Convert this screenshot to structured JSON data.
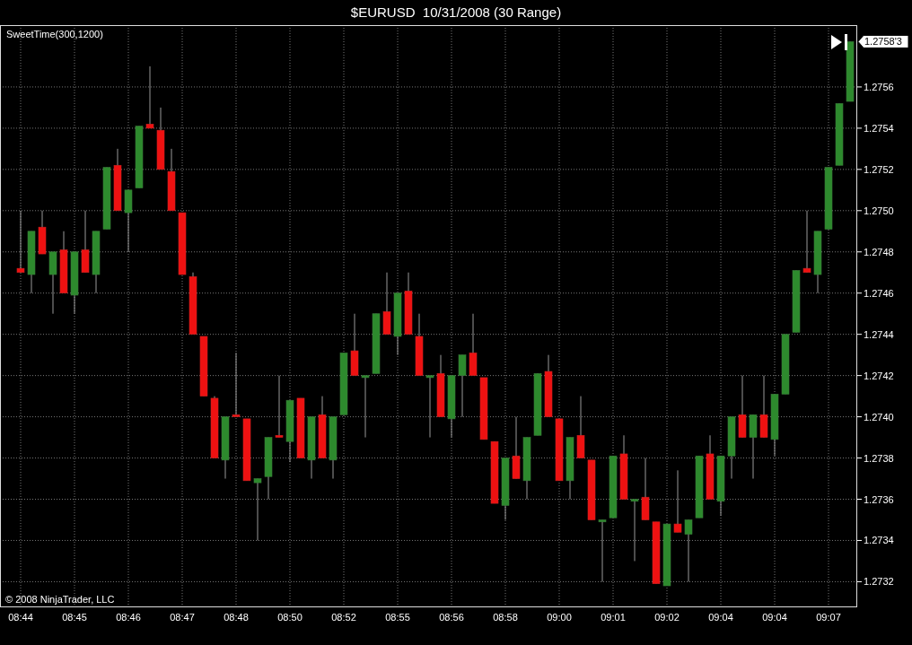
{
  "window": {
    "title": "$EURUSD  10/31/2008 (30 Range)"
  },
  "chart": {
    "indicator_label": "SweetTime(300,1200)",
    "copyright": "© 2008 NinjaTrader, LLC",
    "last_price": "1.2758'3",
    "chart_data": {
      "type": "candlestick",
      "grid": true,
      "ylim": [
        1.27308,
        1.2759
      ],
      "categories": [
        "08:44",
        null,
        null,
        null,
        null,
        "08:45",
        null,
        null,
        null,
        null,
        "08:46",
        null,
        null,
        null,
        null,
        "08:47",
        null,
        null,
        null,
        null,
        "08:48",
        null,
        null,
        null,
        null,
        "08:50",
        null,
        null,
        null,
        null,
        "08:52",
        null,
        null,
        null,
        null,
        "08:55",
        null,
        null,
        null,
        null,
        "08:56",
        null,
        null,
        null,
        null,
        "08:58",
        null,
        null,
        null,
        null,
        "09:00",
        null,
        null,
        null,
        null,
        "09:01",
        null,
        null,
        null,
        null,
        "09:02",
        null,
        null,
        null,
        null,
        "09:04",
        null,
        null,
        null,
        null,
        "09:04",
        null,
        null,
        null,
        null,
        "09:07",
        null,
        null
      ],
      "yticks": [
        {
          "value": 1.2732,
          "label": "1.2732"
        },
        {
          "value": 1.2734,
          "label": "1.2734"
        },
        {
          "value": 1.2736,
          "label": "1.2736"
        },
        {
          "value": 1.2738,
          "label": "1.2738"
        },
        {
          "value": 1.274,
          "label": "1.2740"
        },
        {
          "value": 1.2742,
          "label": "1.2742"
        },
        {
          "value": 1.2744,
          "label": "1.2744"
        },
        {
          "value": 1.2746,
          "label": "1.2746"
        },
        {
          "value": 1.2748,
          "label": "1.2748"
        },
        {
          "value": 1.275,
          "label": "1.2750"
        },
        {
          "value": 1.2752,
          "label": "1.2752"
        },
        {
          "value": 1.2754,
          "label": "1.2754"
        },
        {
          "value": 1.2756,
          "label": "1.2756"
        }
      ],
      "ohlc": [
        [
          1.27472,
          1.275,
          1.2747,
          1.2747
        ],
        [
          1.27469,
          1.2749,
          1.2746,
          1.2749
        ],
        [
          1.27492,
          1.275,
          1.27479,
          1.27479
        ],
        [
          1.27469,
          1.2748,
          1.2745,
          1.2748
        ],
        [
          1.27481,
          1.2749,
          1.2746,
          1.2746
        ],
        [
          1.27459,
          1.2748,
          1.2745,
          1.2748
        ],
        [
          1.27481,
          1.275,
          1.2747,
          1.2747
        ],
        [
          1.27469,
          1.2749,
          1.2746,
          1.2749
        ],
        [
          1.27491,
          1.27521,
          1.27491,
          1.27521
        ],
        [
          1.27522,
          1.2753,
          1.275,
          1.275
        ],
        [
          1.27499,
          1.2751,
          1.2748,
          1.2751
        ],
        [
          1.27511,
          1.27541,
          1.27511,
          1.27541
        ],
        [
          1.27542,
          1.2757,
          1.2754,
          1.2754
        ],
        [
          1.27539,
          1.2755,
          1.2752,
          1.2752
        ],
        [
          1.27519,
          1.2753,
          1.275,
          1.275
        ],
        [
          1.27499,
          1.27499,
          1.27469,
          1.27469
        ],
        [
          1.27468,
          1.2747,
          1.2744,
          1.2744
        ],
        [
          1.27439,
          1.27439,
          1.2741,
          1.2741
        ],
        [
          1.27409,
          1.2741,
          1.2738,
          1.2738
        ],
        [
          1.27379,
          1.274,
          1.2737,
          1.274
        ],
        [
          1.27401,
          1.27431,
          1.274,
          1.274
        ],
        [
          1.27399,
          1.27399,
          1.27369,
          1.27369
        ],
        [
          1.27368,
          1.2737,
          1.2734,
          1.2737
        ],
        [
          1.27371,
          1.2739,
          1.2736,
          1.2739
        ],
        [
          1.27391,
          1.2742,
          1.2739,
          1.2739
        ],
        [
          1.27388,
          1.27408,
          1.27378,
          1.27408
        ],
        [
          1.27409,
          1.27409,
          1.2738,
          1.2738
        ],
        [
          1.27379,
          1.274,
          1.2737,
          1.274
        ],
        [
          1.27401,
          1.2741,
          1.2738,
          1.2738
        ],
        [
          1.27379,
          1.274,
          1.2737,
          1.274
        ],
        [
          1.27401,
          1.27431,
          1.27401,
          1.27431
        ],
        [
          1.27432,
          1.2745,
          1.2742,
          1.2742
        ],
        [
          1.27419,
          1.2742,
          1.2739,
          1.2742
        ],
        [
          1.27421,
          1.2745,
          1.27421,
          1.2745
        ],
        [
          1.27451,
          1.2747,
          1.2744,
          1.2744
        ],
        [
          1.27439,
          1.2746,
          1.2743,
          1.2746
        ],
        [
          1.27461,
          1.2747,
          1.2744,
          1.2744
        ],
        [
          1.27439,
          1.2745,
          1.2742,
          1.2742
        ],
        [
          1.27419,
          1.2742,
          1.2739,
          1.2742
        ],
        [
          1.27421,
          1.2743,
          1.274,
          1.274
        ],
        [
          1.27399,
          1.2742,
          1.2739,
          1.2742
        ],
        [
          1.2742,
          1.2743,
          1.274,
          1.2743
        ],
        [
          1.27431,
          1.2745,
          1.2742,
          1.2742
        ],
        [
          1.27419,
          1.27419,
          1.27389,
          1.27389
        ],
        [
          1.27388,
          1.27388,
          1.27358,
          1.27358
        ],
        [
          1.27357,
          1.2738,
          1.2735,
          1.2738
        ],
        [
          1.27381,
          1.274,
          1.2737,
          1.2737
        ],
        [
          1.27369,
          1.2739,
          1.2736,
          1.2739
        ],
        [
          1.27391,
          1.27421,
          1.27391,
          1.27421
        ],
        [
          1.27422,
          1.2743,
          1.274,
          1.274
        ],
        [
          1.27399,
          1.27399,
          1.27369,
          1.27369
        ],
        [
          1.27369,
          1.2739,
          1.2736,
          1.2739
        ],
        [
          1.27391,
          1.2741,
          1.2738,
          1.2738
        ],
        [
          1.27379,
          1.27379,
          1.2735,
          1.2735
        ],
        [
          1.27349,
          1.2735,
          1.2732,
          1.2735
        ],
        [
          1.27351,
          1.27381,
          1.27351,
          1.27381
        ],
        [
          1.27382,
          1.27391,
          1.2736,
          1.2736
        ],
        [
          1.27359,
          1.2736,
          1.2733,
          1.2736
        ],
        [
          1.27361,
          1.2738,
          1.2735,
          1.2735
        ],
        [
          1.27349,
          1.27349,
          1.27319,
          1.27319
        ],
        [
          1.27318,
          1.27348,
          1.27318,
          1.27348
        ],
        [
          1.27348,
          1.27374,
          1.27344,
          1.27344
        ],
        [
          1.27343,
          1.2735,
          1.2732,
          1.2735
        ],
        [
          1.27351,
          1.27381,
          1.27351,
          1.27381
        ],
        [
          1.27382,
          1.27391,
          1.2736,
          1.2736
        ],
        [
          1.27359,
          1.27381,
          1.27352,
          1.27381
        ],
        [
          1.27381,
          1.274,
          1.2737,
          1.274
        ],
        [
          1.27401,
          1.2742,
          1.2739,
          1.2739
        ],
        [
          1.2739,
          1.27401,
          1.2737,
          1.27401
        ],
        [
          1.27401,
          1.2742,
          1.2739,
          1.2739
        ],
        [
          1.27389,
          1.27411,
          1.27381,
          1.27411
        ],
        [
          1.27411,
          1.2744,
          1.27411,
          1.2744
        ],
        [
          1.27441,
          1.27471,
          1.27441,
          1.27471
        ],
        [
          1.27472,
          1.275,
          1.2747,
          1.2747
        ],
        [
          1.27469,
          1.2749,
          1.2746,
          1.2749
        ],
        [
          1.27491,
          1.27521,
          1.27491,
          1.27521
        ],
        [
          1.27522,
          1.27552,
          1.27522,
          1.27552
        ],
        [
          1.27553,
          1.27582,
          1.27553,
          1.27582
        ]
      ]
    }
  }
}
